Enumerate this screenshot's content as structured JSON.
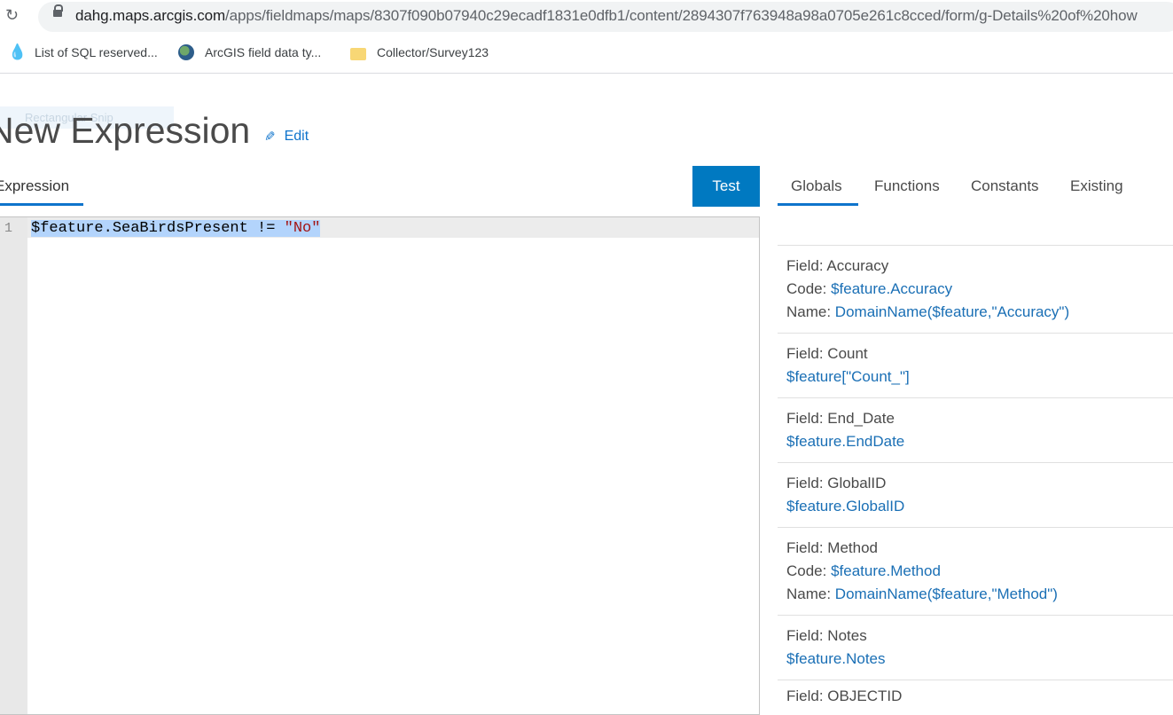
{
  "browser": {
    "url_host": "dahg.maps.arcgis.com",
    "url_path": "/apps/fieldmaps/maps/8307f090b07940c29ecadf1831e0dfb1/content/2894307f763948a98a0705e261c8cced/form/g-Details%20of%20how",
    "bookmarks": [
      {
        "label": "List of SQL reserved...",
        "icon": "drupal-icon"
      },
      {
        "label": "ArcGIS field data ty...",
        "icon": "globe-icon"
      },
      {
        "label": "Collector/Survey123",
        "icon": "folder-icon"
      }
    ]
  },
  "ghost_overlay": "Rectangular Snip",
  "header": {
    "title": "New Expression",
    "edit_label": "Edit"
  },
  "editor": {
    "tab_label": "Expression",
    "test_label": "Test",
    "line_number": "1",
    "code_part1": "$feature.SeaBirdsPresent != ",
    "code_string": "\"No\""
  },
  "right_panel": {
    "tabs": [
      "Globals",
      "Functions",
      "Constants",
      "Existing"
    ],
    "active_tab": "Globals",
    "entries": [
      {
        "field": "Field: Accuracy",
        "code_prefix": "Code: ",
        "code": "$feature.Accuracy",
        "name_prefix": "Name: ",
        "name": "DomainName($feature,\"Accuracy\")"
      },
      {
        "field": "Field: Count",
        "code": "$feature[\"Count_\"]"
      },
      {
        "field": "Field: End_Date",
        "code": "$feature.EndDate"
      },
      {
        "field": "Field: GlobalID",
        "code": "$feature.GlobalID"
      },
      {
        "field": "Field: Method",
        "code_prefix": "Code: ",
        "code": "$feature.Method",
        "name_prefix": "Name: ",
        "name": "DomainName($feature,\"Method\")"
      },
      {
        "field": "Field: Notes",
        "code": "$feature.Notes"
      }
    ],
    "partial_entry": "Field: OBJECTID"
  }
}
